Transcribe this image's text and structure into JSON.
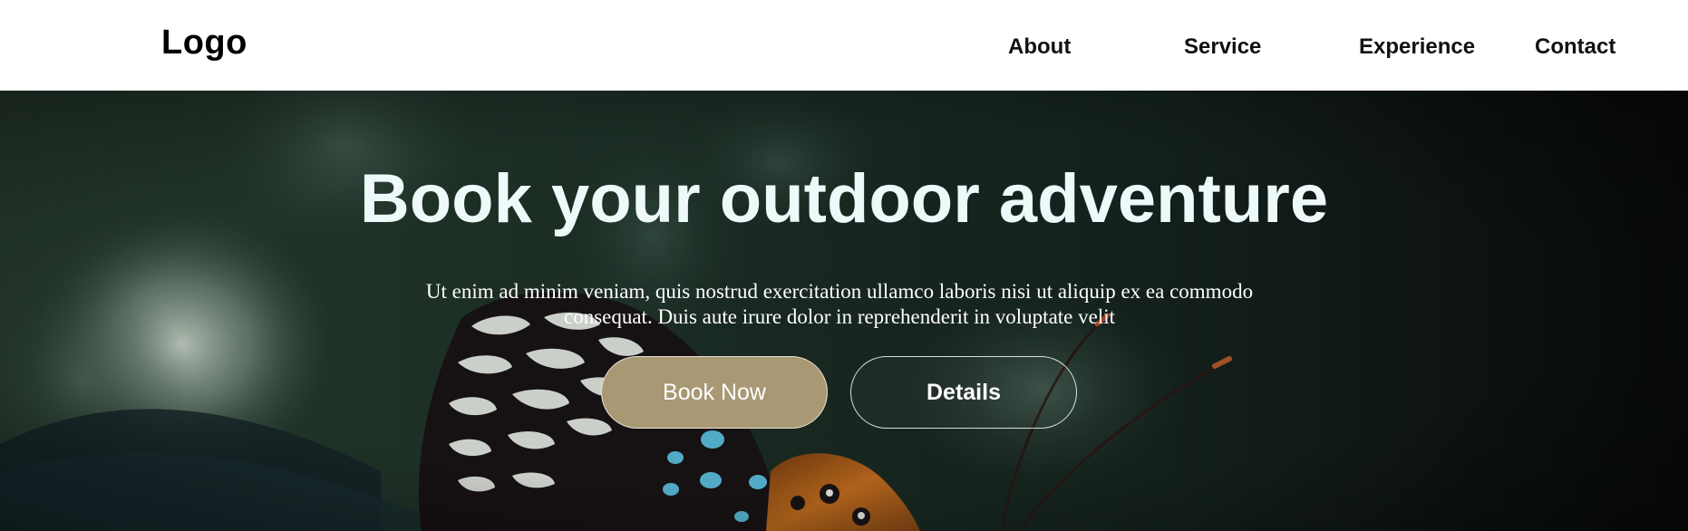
{
  "header": {
    "logo": "Logo",
    "nav": [
      "About",
      "Service",
      "Experience",
      "Contact"
    ]
  },
  "hero": {
    "title": "Book your outdoor adventure",
    "text": "Ut enim ad minim veniam, quis nostrud exercitation ullamco laboris nisi ut aliquip ex ea commodo consequat. Duis aute irure dolor in reprehenderit in voluptate velit",
    "primary_button": "Book Now",
    "secondary_button": "Details",
    "background_image": "butterfly-photo",
    "colors": {
      "accent": "#a89874",
      "title": "#eef9fa",
      "background": "#1c2e26"
    }
  }
}
